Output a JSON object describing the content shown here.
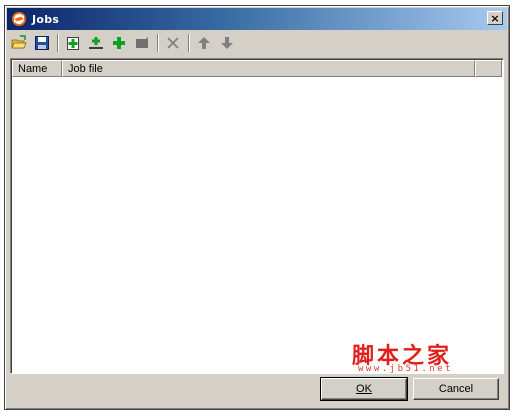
{
  "window": {
    "title": "Jobs",
    "close_glyph": "×"
  },
  "toolbar": {
    "buttons": [
      {
        "icon": "open-folder-icon"
      },
      {
        "icon": "save-disk-icon"
      },
      {
        "icon": "new-job-icon"
      },
      {
        "icon": "insert-job-icon"
      },
      {
        "icon": "add-job-icon"
      },
      {
        "icon": "edit-job-icon"
      },
      {
        "icon": "delete-icon"
      },
      {
        "icon": "move-up-icon"
      },
      {
        "icon": "move-down-icon"
      }
    ]
  },
  "list": {
    "columns": [
      "Name",
      "Job file"
    ],
    "rows": []
  },
  "watermark": {
    "text": "脚本之家",
    "url": "www.jb51.net",
    "color": "#e0201a"
  },
  "footer": {
    "ok_label": "OK",
    "cancel_label": "Cancel"
  },
  "colors": {
    "face": "#d4d0c8",
    "title_start": "#0a246a",
    "title_end": "#a6caf0"
  }
}
